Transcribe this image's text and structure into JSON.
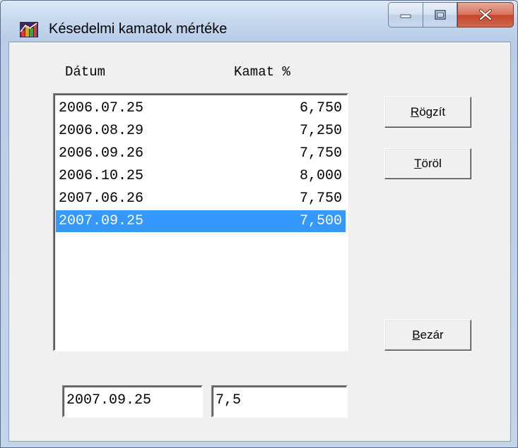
{
  "window": {
    "title": "Késedelmi kamatok mértéke"
  },
  "columns": {
    "date": "Dátum",
    "rate": "Kamat %"
  },
  "rows": [
    {
      "date": "2006.07.25",
      "rate": "6,750",
      "selected": false
    },
    {
      "date": "2006.08.29",
      "rate": "7,250",
      "selected": false
    },
    {
      "date": "2006.09.26",
      "rate": "7,750",
      "selected": false
    },
    {
      "date": "2006.10.25",
      "rate": "8,000",
      "selected": false
    },
    {
      "date": "2007.06.26",
      "rate": "7,750",
      "selected": false
    },
    {
      "date": "2007.09.25",
      "rate": "7,500",
      "selected": true
    }
  ],
  "buttons": {
    "save": {
      "mnemonic": "R",
      "rest": "ögzít"
    },
    "delete": {
      "mnemonic": "T",
      "rest": "öröl"
    },
    "close": {
      "mnemonic": "B",
      "rest": "ezár"
    }
  },
  "fields": {
    "date_value": "2007.09.25",
    "rate_value": "7,5"
  },
  "colors": {
    "selection": "#3399ff",
    "close_button": "#c4452a"
  },
  "icons": {
    "app": "chart-app-icon",
    "minimize": "minimize-icon",
    "maximize": "maximize-icon",
    "close": "close-icon"
  }
}
